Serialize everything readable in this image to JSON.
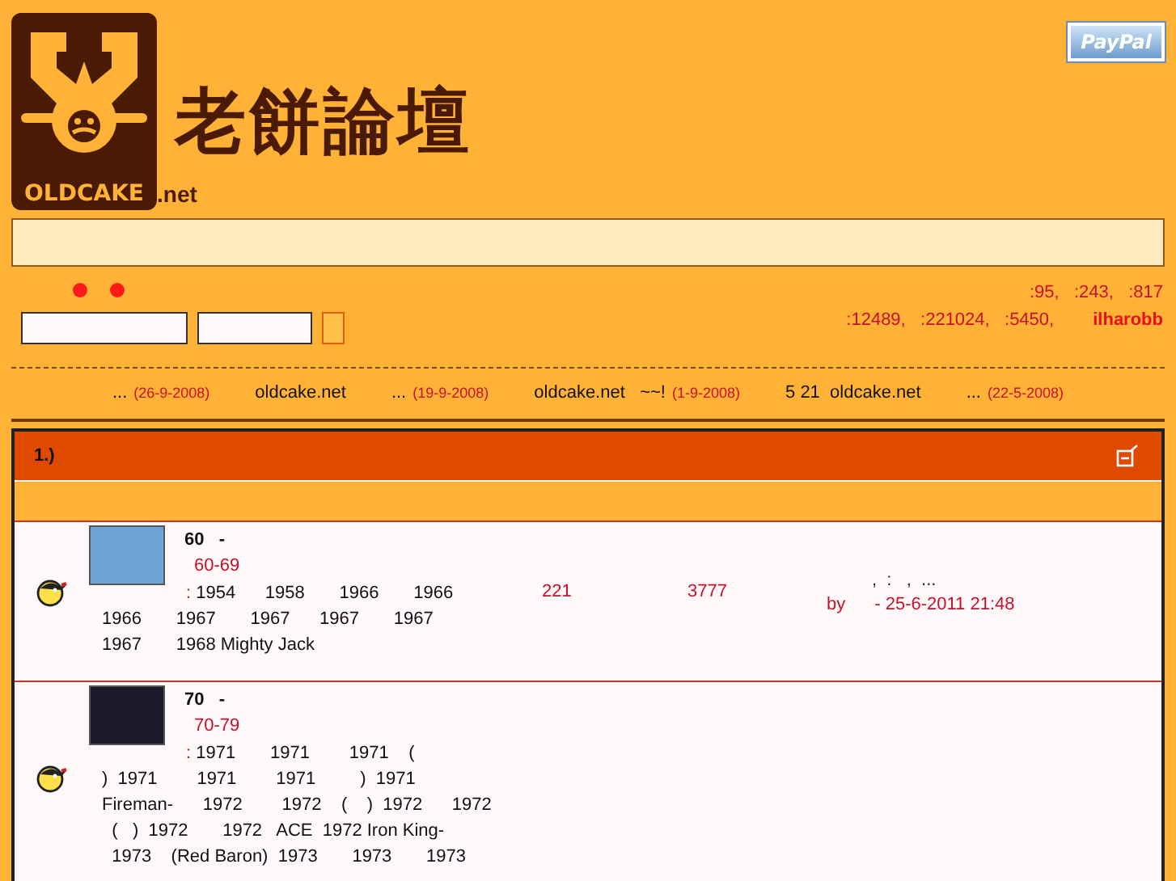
{
  "header": {
    "logo_text": "OLDCAKE",
    "logo_suffix": ".net",
    "title": "老餅論壇",
    "paypal": "PayPal"
  },
  "stats": {
    "lines": [
      ":95,   :243,   :817",
      ":12489,   :221024,   :5450,"
    ],
    "user": "ilharobb"
  },
  "announcements": [
    {
      "text": "...",
      "date": "(26-9-2008)"
    },
    {
      "text": "oldcake.net"
    },
    {
      "text": "...",
      "date": "(19-9-2008)"
    },
    {
      "text": "oldcake.net   ~~!",
      "date": "(1-9-2008)"
    },
    {
      "text": "5 21  oldcake.net"
    },
    {
      "text": "...",
      "date": "(22-5-2008)"
    }
  ],
  "category": {
    "title": "1.)"
  },
  "forums": [
    {
      "title": "60   -",
      "subtitle": "60-69",
      "lead": ":",
      "lines": [
        " 1954      1958       1966       1966",
        "1966       1967       1967      1967       1967",
        "1967       1968 Mighty Jack"
      ],
      "topics": "221",
      "posts": "3777",
      "last_title": ",  :   ,  ...",
      "last_by": "by",
      "last_time": "- 25-6-2011 21:48"
    },
    {
      "title": "70   -",
      "subtitle": "70-79",
      "lead": ":",
      "lines": [
        " 1971       1971        1971    (",
        ")  1971        1971        1971         )  1971",
        "Fireman-      1972        1972    (    )  1972      1972",
        "  (   )  1972       1972   ACE  1972 Iron King-",
        "  1973    (Red Baron)  1973       1973       1973"
      ]
    }
  ]
}
